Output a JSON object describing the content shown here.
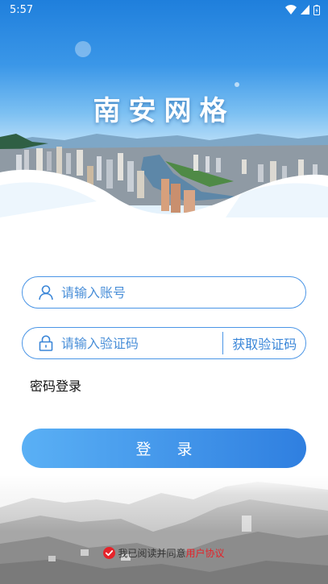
{
  "status_bar": {
    "time": "5:57",
    "icons": [
      "wifi-icon",
      "signal-icon",
      "battery-icon"
    ]
  },
  "header": {
    "title": "南安网格"
  },
  "form": {
    "account_placeholder": "请输入账号",
    "code_placeholder": "请输入验证码",
    "get_code_label": "获取验证码",
    "account_icon": "user-icon",
    "code_icon": "lock-icon"
  },
  "password_login_label": "密码登录",
  "login_button_label": "登录",
  "agreement": {
    "checked": true,
    "prefix": "我已阅读并同意",
    "link_label": "用户协议"
  },
  "colors": {
    "primary": "#3a86d8",
    "button_start": "#5ab0f5",
    "button_end": "#2f7fe0",
    "link": "#e5232a"
  }
}
